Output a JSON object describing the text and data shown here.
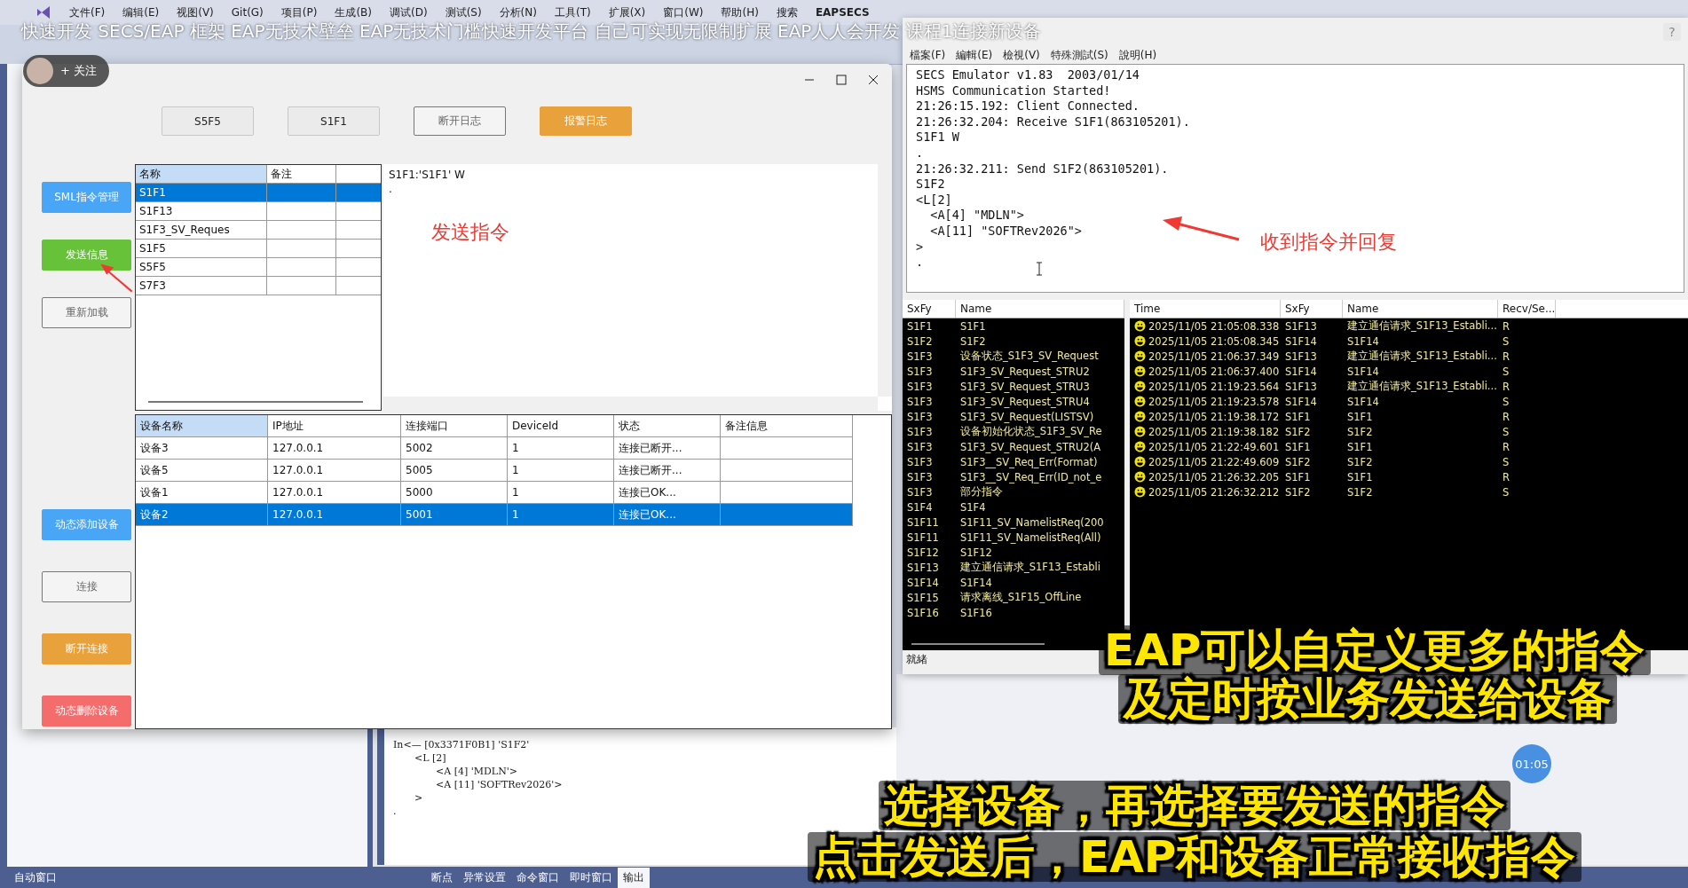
{
  "ide": {
    "menu": [
      "文件(F)",
      "编辑(E)",
      "视图(V)",
      "Git(G)",
      "项目(P)",
      "生成(B)",
      "调试(D)",
      "测试(S)",
      "分析(N)",
      "工具(T)",
      "扩展(X)",
      "窗口(W)",
      "帮助(H)"
    ],
    "search": "搜索",
    "app_name": "EAPSECS",
    "output": [
      {
        "text": "In<— [0x3371F0B1] 'S1F2'",
        "children": [
          {
            "text": "<L [2]",
            "children": [
              {
                "text": "<A [4] 'MDLN'>"
              },
              {
                "text": "<A [11] 'SOFTRev2026'>"
              }
            ]
          },
          {
            "text": ">"
          }
        ]
      },
      {
        "text": "."
      }
    ],
    "left_tabs": [
      {
        "label": "自动窗口",
        "selected": false
      }
    ],
    "right_tabs": [
      {
        "label": "断点",
        "selected": false
      },
      {
        "label": "异常设置",
        "selected": false
      },
      {
        "label": "命令窗口",
        "selected": false
      },
      {
        "label": "即时窗口",
        "selected": false
      },
      {
        "label": "输出",
        "selected": true
      }
    ]
  },
  "main_window": {
    "top_buttons": [
      {
        "label": "S5F5",
        "kind": "plain"
      },
      {
        "label": "S1F1",
        "kind": "plain"
      },
      {
        "label": "断开日志",
        "kind": "outline"
      },
      {
        "label": "报警日志",
        "kind": "orange"
      }
    ],
    "side_buttons_upper": [
      {
        "label": "SML指令管理",
        "kind": "blue"
      },
      {
        "label": "发送信息",
        "kind": "green"
      },
      {
        "label": "重新加载",
        "kind": "outline"
      }
    ],
    "side_buttons_lower": [
      {
        "label": "动态添加设备",
        "kind": "blue"
      },
      {
        "label": "连接",
        "kind": "outline"
      },
      {
        "label": "断开连接",
        "kind": "orange"
      },
      {
        "label": "动态删除设备",
        "kind": "red"
      }
    ],
    "commands": {
      "columns": [
        "名称",
        "备注"
      ],
      "rows": [
        {
          "name": "S1F1",
          "selected": true
        },
        {
          "name": "S1F13",
          "selected": false
        },
        {
          "name": "S1F3_SV_Reques",
          "selected": false
        },
        {
          "name": "S1F5",
          "selected": false
        },
        {
          "name": "S5F5",
          "selected": false
        },
        {
          "name": "S7F3",
          "selected": false
        }
      ]
    },
    "preview": [
      "S1F1:'S1F1' W",
      "."
    ],
    "annotation": "发送指令",
    "devices": {
      "columns": [
        "设备名称",
        "IP地址",
        "连接端口",
        "DeviceId",
        "状态",
        "备注信息"
      ],
      "rows": [
        {
          "cells": [
            "设备3",
            "127.0.0.1",
            "5002",
            "1",
            "连接已断开..."
          ],
          "selected": false
        },
        {
          "cells": [
            "设备5",
            "127.0.0.1",
            "5005",
            "1",
            "连接已断开..."
          ],
          "selected": false
        },
        {
          "cells": [
            "设备1",
            "127.0.0.1",
            "5000",
            "1",
            "连接已OK..."
          ],
          "selected": false
        },
        {
          "cells": [
            "设备2",
            "127.0.0.1",
            "5001",
            "1",
            "连接已OK..."
          ],
          "selected": true
        }
      ]
    }
  },
  "emulator": {
    "menu": [
      "檔案(F)",
      "編輯(E)",
      "檢視(V)",
      "特殊測試(S)",
      "說明(H)"
    ],
    "log": [
      "SECS Emulator v1.83  2003/01/14",
      "HSMS Communication Started!",
      "21:26:15.192: Client Connected.",
      "21:26:32.204: Receive S1F1(863105201).",
      "S1F1 W",
      ".",
      "21:26:32.211: Send S1F2(863105201).",
      "S1F2",
      "<L[2]",
      "  <A[4] \"MDLN\">",
      "  <A[11] \"SOFTRev2026\">",
      ">",
      "."
    ],
    "annotation": "收到指令并回复",
    "messages": {
      "columns": [
        "SxFy",
        "Name"
      ],
      "rows": [
        [
          "S1F1",
          "S1F1"
        ],
        [
          "S1F2",
          "S1F2"
        ],
        [
          "S1F3",
          "设备状态_S1F3_SV_Request"
        ],
        [
          "S1F3",
          "S1F3_SV_Request_STRU2"
        ],
        [
          "S1F3",
          "S1F3_SV_Request_STRU3"
        ],
        [
          "S1F3",
          "S1F3_SV_Request_STRU4"
        ],
        [
          "S1F3",
          "S1F3_SV_Request(LISTSV)"
        ],
        [
          "S1F3",
          "设备初始化状态_S1F3_SV_Re"
        ],
        [
          "S1F3",
          "S1F3_SV_Request_STRU2(A"
        ],
        [
          "S1F3",
          "S1F3__SV_Req_Err(Format)"
        ],
        [
          "S1F3",
          "S1F3__SV_Req_Err(ID_not_e"
        ],
        [
          "S1F3",
          "部分指令"
        ],
        [
          "S1F4",
          "S1F4"
        ],
        [
          "S1F11",
          "S1F11_SV_NamelistReq(200"
        ],
        [
          "S1F11",
          "S1F11_SV_NamelistReq(All)"
        ],
        [
          "S1F12",
          "S1F12"
        ],
        [
          "S1F13",
          "建立通信请求_S1F13_Establi"
        ],
        [
          "S1F14",
          "S1F14"
        ],
        [
          "S1F15",
          "请求离线_S1F15_OffLine"
        ],
        [
          "S1F16",
          "S1F16"
        ]
      ]
    },
    "history": {
      "columns": [
        "Time",
        "SxFy",
        "Name",
        "Recv/Se..."
      ],
      "rows": [
        [
          "2025/11/05 21:05:08.338",
          "S1F13",
          "建立通信请求_S1F13_Establi...",
          "R"
        ],
        [
          "2025/11/05 21:05:08.345",
          "S1F14",
          "S1F14",
          "S"
        ],
        [
          "2025/11/05 21:06:37.349",
          "S1F13",
          "建立通信请求_S1F13_Establi...",
          "R"
        ],
        [
          "2025/11/05 21:06:37.400",
          "S1F14",
          "S1F14",
          "S"
        ],
        [
          "2025/11/05 21:19:23.564",
          "S1F13",
          "建立通信请求_S1F13_Establi...",
          "R"
        ],
        [
          "2025/11/05 21:19:23.578",
          "S1F14",
          "S1F14",
          "S"
        ],
        [
          "2025/11/05 21:19:38.172",
          "S1F1",
          "S1F1",
          "R"
        ],
        [
          "2025/11/05 21:19:38.182",
          "S1F2",
          "S1F2",
          "S"
        ],
        [
          "2025/11/05 21:22:49.601",
          "S1F1",
          "S1F1",
          "R"
        ],
        [
          "2025/11/05 21:22:49.609",
          "S1F2",
          "S1F2",
          "S"
        ],
        [
          "2025/11/05 21:26:32.205",
          "S1F1",
          "S1F1",
          "R"
        ],
        [
          "2025/11/05 21:26:32.212",
          "S1F2",
          "S1F2",
          "S"
        ]
      ]
    },
    "status": "就緒",
    "help": "?"
  },
  "video_overlay": {
    "title": "快速开发 SECS/EAP 框架 EAP无技术壁垒 EAP无技术门槛快速开发平台 自己可实现无限制扩展 EAP人人会开发 课程1连接新设备",
    "follow": "+ 关注",
    "timer": "01:05",
    "captions": [
      "EAP可以自定义更多的指令",
      "及定时按业务发送给设备",
      "选择设备，再选择要发送的指令",
      "点击发送后，EAP和设备正常接收指令"
    ]
  }
}
